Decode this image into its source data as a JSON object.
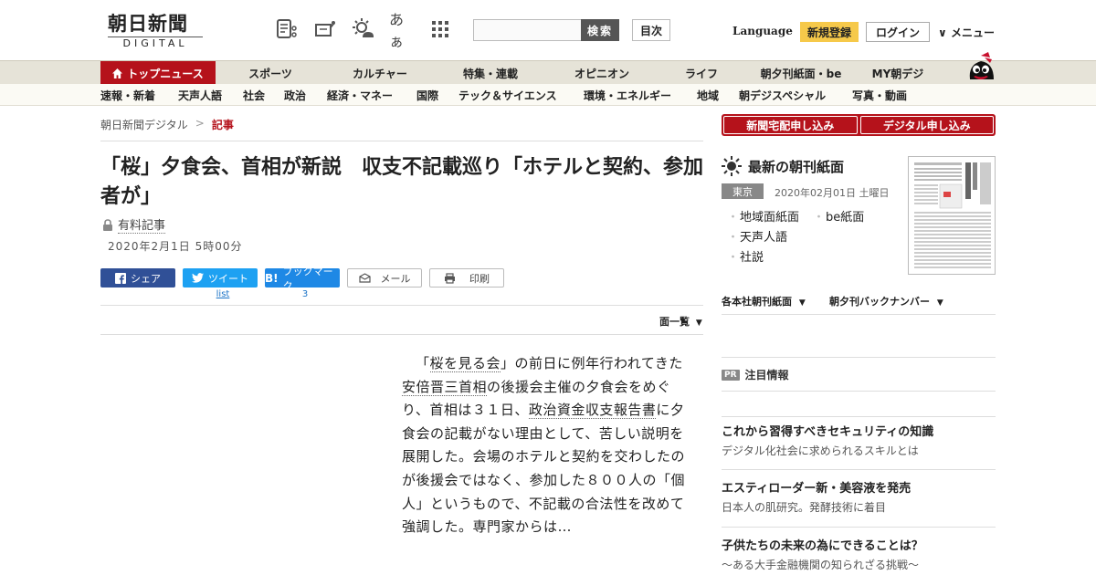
{
  "header": {
    "logo_main": "朝日新聞",
    "logo_sub": "DIGITAL",
    "font_size_label": "あぁ",
    "search_button": "検索",
    "toc_button": "目次",
    "language": "Language",
    "signup": "新規登録",
    "login": "ログイン",
    "menu": "メニュー"
  },
  "nav_primary": [
    {
      "label": "トップニュース",
      "active": true
    },
    {
      "label": "スポーツ"
    },
    {
      "label": "カルチャー"
    },
    {
      "label": "特集・連載"
    },
    {
      "label": "オピニオン"
    },
    {
      "label": "ライフ"
    },
    {
      "label": "朝夕刊紙面・be"
    },
    {
      "label": "MY朝デジ"
    }
  ],
  "nav_secondary": [
    "速報・新着",
    "天声人語",
    "社会",
    "政治",
    "経済・マネー",
    "国際",
    "テック＆サイエンス",
    "環境・エネルギー",
    "地域",
    "朝デジスペシャル",
    "写真・動画"
  ],
  "breadcrumb": {
    "home": "朝日新聞デジタル",
    "separator": ">",
    "current": "記事"
  },
  "article": {
    "title": "「桜」夕食会、首相が新説　収支不記載巡り「ホテルと契約、参加者が」",
    "paid_label": "有料記事",
    "date": "2020年2月1日 5時00分",
    "body": {
      "p1": "「",
      "k1": "桜を見る会",
      "p2": "」の前日に例年行われてきた",
      "k2": "安倍晋三首相",
      "p3": "の後援会主催の夕食会をめぐり、首相は３１日、",
      "k3": "政治資金収支報告書",
      "p4": "に夕食会の記載がない理由として、苦しい説明を展開した。会場のホテルと契約を交わしたのが後援会ではなく、参加した８００人の「個人」というもので、不記載の合法性を改めて強調した。専門家からは…"
    }
  },
  "share": {
    "facebook": "シェア",
    "twitter": "ツイート",
    "hatena": "ブックマーク",
    "mail": "メール",
    "print": "印刷",
    "twitter_count": "list",
    "hatena_count": "3"
  },
  "mens_list": "面一覧",
  "sidebar": {
    "delivery_button": "新聞宅配申し込み",
    "digital_button": "デジタル申し込み",
    "paper_title": "最新の朝刊紙面",
    "region": "東京",
    "paper_date": "2020年02月01日 土曜日",
    "links": [
      "地域面紙面",
      "be紙面",
      "天声人語",
      "社説"
    ],
    "dropdown_1": "各本社朝刊紙面",
    "dropdown_2": "朝夕刊バックナンバー",
    "pr_badge": "PR",
    "pr_heading": "注目情報",
    "pr_items": [
      {
        "title": "これから習得すべきセキュリティの知識",
        "sub": "デジタル化社会に求められるスキルとは"
      },
      {
        "title": "エスティローダー新・美容液を発売",
        "sub": "日本人の肌研究。発酵技術に着目"
      },
      {
        "title": "子供たちの未来の為にできることは？",
        "sub": "～ある大手金融機関の知られざる挑戦～"
      }
    ]
  },
  "colors": {
    "brand_red": "#b5121b",
    "signup_yellow": "#f6c94a",
    "facebook": "#305097",
    "twitter": "#1da1f2",
    "hatena": "#1e88e5"
  }
}
